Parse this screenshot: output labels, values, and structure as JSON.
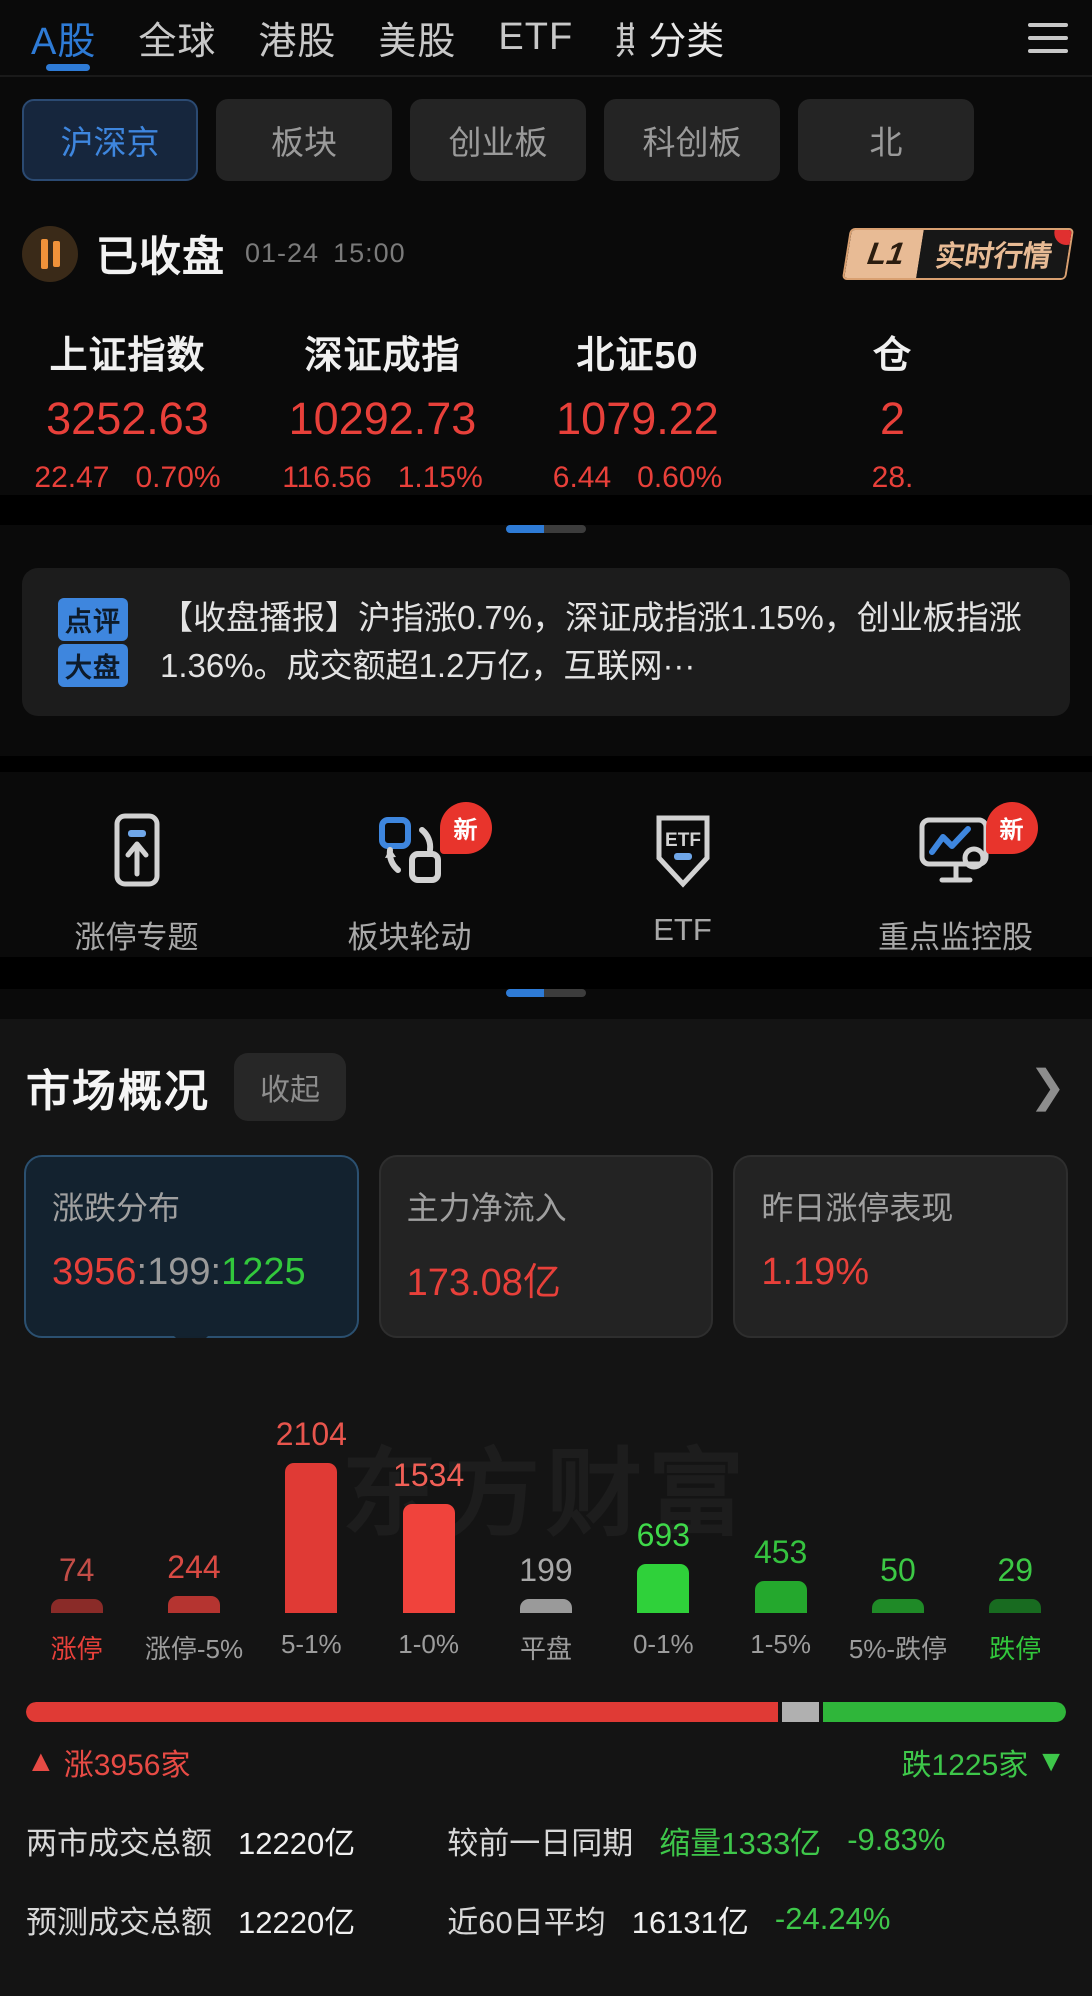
{
  "topnav": {
    "items": [
      {
        "label": "A股",
        "active": true
      },
      {
        "label": "全球",
        "active": false
      },
      {
        "label": "港股",
        "active": false
      },
      {
        "label": "美股",
        "active": false
      },
      {
        "label": "ETF",
        "active": false
      },
      {
        "label": "期",
        "active": false
      }
    ],
    "category_label": "分类",
    "menu_icon": "hamburger-menu-icon"
  },
  "subtabs": [
    {
      "label": "沪深京",
      "active": true
    },
    {
      "label": "板块",
      "active": false
    },
    {
      "label": "创业板",
      "active": false
    },
    {
      "label": "科创板",
      "active": false
    },
    {
      "label": "北",
      "active": false
    }
  ],
  "status": {
    "label": "已收盘",
    "date": "01-24",
    "time": "15:00",
    "badge_level": "L1",
    "badge_text": "实时行情",
    "icon": "market-status-icon"
  },
  "indices": [
    {
      "name": "上证指数",
      "value": "3252.63",
      "change": "22.47",
      "percent": "0.70%",
      "color": "#e8403a"
    },
    {
      "name": "深证成指",
      "value": "10292.73",
      "change": "116.56",
      "percent": "1.15%",
      "color": "#e8403a"
    },
    {
      "name": "北证50",
      "value": "1079.22",
      "change": "6.44",
      "percent": "0.60%",
      "color": "#e8403a"
    },
    {
      "name": "仓",
      "value": "2",
      "change": "28.",
      "percent": "",
      "color": "#e8403a"
    }
  ],
  "news": {
    "badge_top": "点评",
    "badge_bottom": "大盘",
    "text": "【收盘播报】沪指涨0.7%，深证成指涨1.15%，创业板指涨1.36%。成交额超1.2万亿，互联网···"
  },
  "shortcuts": [
    {
      "label": "涨停专题",
      "icon": "limit-up-board-icon",
      "badge": ""
    },
    {
      "label": "板块轮动",
      "icon": "sector-rotation-icon",
      "badge": "新"
    },
    {
      "label": "ETF",
      "icon": "etf-shield-icon",
      "badge": ""
    },
    {
      "label": "重点监控股",
      "icon": "key-monitoring-icon",
      "badge": "新"
    }
  ],
  "market_overview": {
    "title": "市场概况",
    "collapse_label": "收起",
    "chevron": "chevron-right-icon",
    "cards": [
      {
        "title": "涨跌分布",
        "value_up": "3956",
        "sep1": ":",
        "value_flat": "199",
        "sep2": ":",
        "value_down": "1225",
        "active": true
      },
      {
        "title": "主力净流入",
        "value": "173.08亿",
        "active": false
      },
      {
        "title": "昨日涨停表现",
        "value": "1.19%",
        "active": false
      }
    ]
  },
  "chart_data": {
    "type": "bar",
    "title": "涨跌分布",
    "categories": [
      "涨停",
      "涨停-5%",
      "5-1%",
      "1-0%",
      "平盘",
      "0-1%",
      "1-5%",
      "5%-跌停",
      "跌停"
    ],
    "values": [
      74,
      244,
      2104,
      1534,
      199,
      693,
      453,
      50,
      29
    ],
    "colors": [
      "#8a2b28",
      "#b53430",
      "#e03a35",
      "#f0433c",
      "#9a9a9a",
      "#2fd13a",
      "#24a82d",
      "#1f8a27",
      "#186b20"
    ],
    "label_colors": [
      "#c24d47",
      "#d94a43",
      "#e8554d",
      "#f05f56",
      "#a8a8a8",
      "#3fd94a",
      "#35c33f",
      "#3cc945",
      "#3cc945"
    ],
    "tick_colors": [
      "#e8403a",
      "#9c9c9c",
      "#9c9c9c",
      "#9c9c9c",
      "#9c9c9c",
      "#9c9c9c",
      "#9c9c9c",
      "#9c9c9c",
      "#32c83c"
    ],
    "ylim": [
      0,
      2104
    ],
    "xlabel": "",
    "ylabel": "",
    "grid": false,
    "legend": "none",
    "watermark": "东方财富"
  },
  "breadth": {
    "up_pct": 72.3,
    "flat_pct": 3.6,
    "down_pct": 24.1,
    "up_label": "涨3956家",
    "down_label": "跌1225家",
    "up_arrow": "▲",
    "down_arrow": "▼"
  },
  "bottom_stats": [
    {
      "label": "两市成交总额",
      "value": "12220亿",
      "mid_label": "较前一日同期",
      "mid_prefix": "缩量1333亿",
      "mid_value": "-9.83%"
    },
    {
      "label": "预测成交总额",
      "value": "12220亿",
      "mid_label": "近60日平均",
      "mid_prefix": "16131亿",
      "mid_value": "-24.24%"
    }
  ]
}
